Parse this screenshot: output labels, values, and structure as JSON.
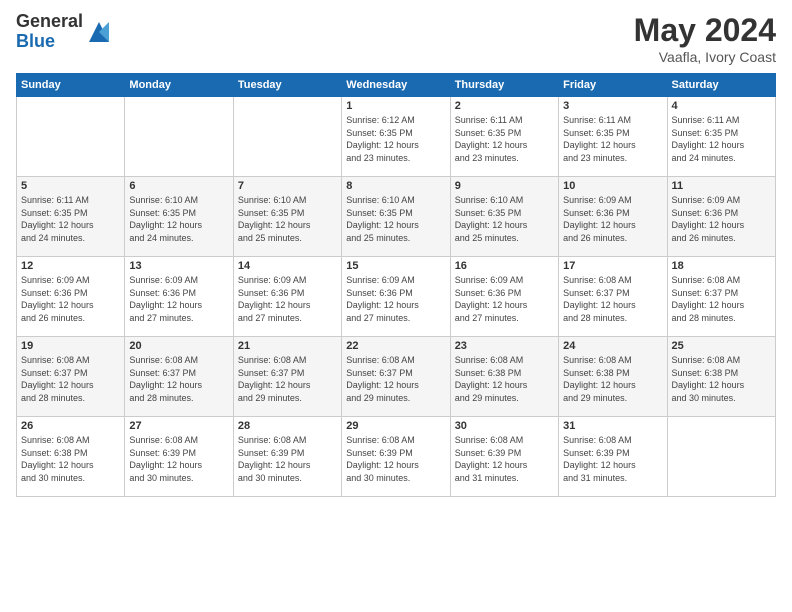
{
  "logo": {
    "general": "General",
    "blue": "Blue"
  },
  "title": "May 2024",
  "subtitle": "Vaafla, Ivory Coast",
  "days_header": [
    "Sunday",
    "Monday",
    "Tuesday",
    "Wednesday",
    "Thursday",
    "Friday",
    "Saturday"
  ],
  "weeks": [
    [
      {
        "num": "",
        "info": ""
      },
      {
        "num": "",
        "info": ""
      },
      {
        "num": "",
        "info": ""
      },
      {
        "num": "1",
        "info": "Sunrise: 6:12 AM\nSunset: 6:35 PM\nDaylight: 12 hours\nand 23 minutes."
      },
      {
        "num": "2",
        "info": "Sunrise: 6:11 AM\nSunset: 6:35 PM\nDaylight: 12 hours\nand 23 minutes."
      },
      {
        "num": "3",
        "info": "Sunrise: 6:11 AM\nSunset: 6:35 PM\nDaylight: 12 hours\nand 23 minutes."
      },
      {
        "num": "4",
        "info": "Sunrise: 6:11 AM\nSunset: 6:35 PM\nDaylight: 12 hours\nand 24 minutes."
      }
    ],
    [
      {
        "num": "5",
        "info": "Sunrise: 6:11 AM\nSunset: 6:35 PM\nDaylight: 12 hours\nand 24 minutes."
      },
      {
        "num": "6",
        "info": "Sunrise: 6:10 AM\nSunset: 6:35 PM\nDaylight: 12 hours\nand 24 minutes."
      },
      {
        "num": "7",
        "info": "Sunrise: 6:10 AM\nSunset: 6:35 PM\nDaylight: 12 hours\nand 25 minutes."
      },
      {
        "num": "8",
        "info": "Sunrise: 6:10 AM\nSunset: 6:35 PM\nDaylight: 12 hours\nand 25 minutes."
      },
      {
        "num": "9",
        "info": "Sunrise: 6:10 AM\nSunset: 6:35 PM\nDaylight: 12 hours\nand 25 minutes."
      },
      {
        "num": "10",
        "info": "Sunrise: 6:09 AM\nSunset: 6:36 PM\nDaylight: 12 hours\nand 26 minutes."
      },
      {
        "num": "11",
        "info": "Sunrise: 6:09 AM\nSunset: 6:36 PM\nDaylight: 12 hours\nand 26 minutes."
      }
    ],
    [
      {
        "num": "12",
        "info": "Sunrise: 6:09 AM\nSunset: 6:36 PM\nDaylight: 12 hours\nand 26 minutes."
      },
      {
        "num": "13",
        "info": "Sunrise: 6:09 AM\nSunset: 6:36 PM\nDaylight: 12 hours\nand 27 minutes."
      },
      {
        "num": "14",
        "info": "Sunrise: 6:09 AM\nSunset: 6:36 PM\nDaylight: 12 hours\nand 27 minutes."
      },
      {
        "num": "15",
        "info": "Sunrise: 6:09 AM\nSunset: 6:36 PM\nDaylight: 12 hours\nand 27 minutes."
      },
      {
        "num": "16",
        "info": "Sunrise: 6:09 AM\nSunset: 6:36 PM\nDaylight: 12 hours\nand 27 minutes."
      },
      {
        "num": "17",
        "info": "Sunrise: 6:08 AM\nSunset: 6:37 PM\nDaylight: 12 hours\nand 28 minutes."
      },
      {
        "num": "18",
        "info": "Sunrise: 6:08 AM\nSunset: 6:37 PM\nDaylight: 12 hours\nand 28 minutes."
      }
    ],
    [
      {
        "num": "19",
        "info": "Sunrise: 6:08 AM\nSunset: 6:37 PM\nDaylight: 12 hours\nand 28 minutes."
      },
      {
        "num": "20",
        "info": "Sunrise: 6:08 AM\nSunset: 6:37 PM\nDaylight: 12 hours\nand 28 minutes."
      },
      {
        "num": "21",
        "info": "Sunrise: 6:08 AM\nSunset: 6:37 PM\nDaylight: 12 hours\nand 29 minutes."
      },
      {
        "num": "22",
        "info": "Sunrise: 6:08 AM\nSunset: 6:37 PM\nDaylight: 12 hours\nand 29 minutes."
      },
      {
        "num": "23",
        "info": "Sunrise: 6:08 AM\nSunset: 6:38 PM\nDaylight: 12 hours\nand 29 minutes."
      },
      {
        "num": "24",
        "info": "Sunrise: 6:08 AM\nSunset: 6:38 PM\nDaylight: 12 hours\nand 29 minutes."
      },
      {
        "num": "25",
        "info": "Sunrise: 6:08 AM\nSunset: 6:38 PM\nDaylight: 12 hours\nand 30 minutes."
      }
    ],
    [
      {
        "num": "26",
        "info": "Sunrise: 6:08 AM\nSunset: 6:38 PM\nDaylight: 12 hours\nand 30 minutes."
      },
      {
        "num": "27",
        "info": "Sunrise: 6:08 AM\nSunset: 6:39 PM\nDaylight: 12 hours\nand 30 minutes."
      },
      {
        "num": "28",
        "info": "Sunrise: 6:08 AM\nSunset: 6:39 PM\nDaylight: 12 hours\nand 30 minutes."
      },
      {
        "num": "29",
        "info": "Sunrise: 6:08 AM\nSunset: 6:39 PM\nDaylight: 12 hours\nand 30 minutes."
      },
      {
        "num": "30",
        "info": "Sunrise: 6:08 AM\nSunset: 6:39 PM\nDaylight: 12 hours\nand 31 minutes."
      },
      {
        "num": "31",
        "info": "Sunrise: 6:08 AM\nSunset: 6:39 PM\nDaylight: 12 hours\nand 31 minutes."
      },
      {
        "num": "",
        "info": ""
      }
    ]
  ]
}
